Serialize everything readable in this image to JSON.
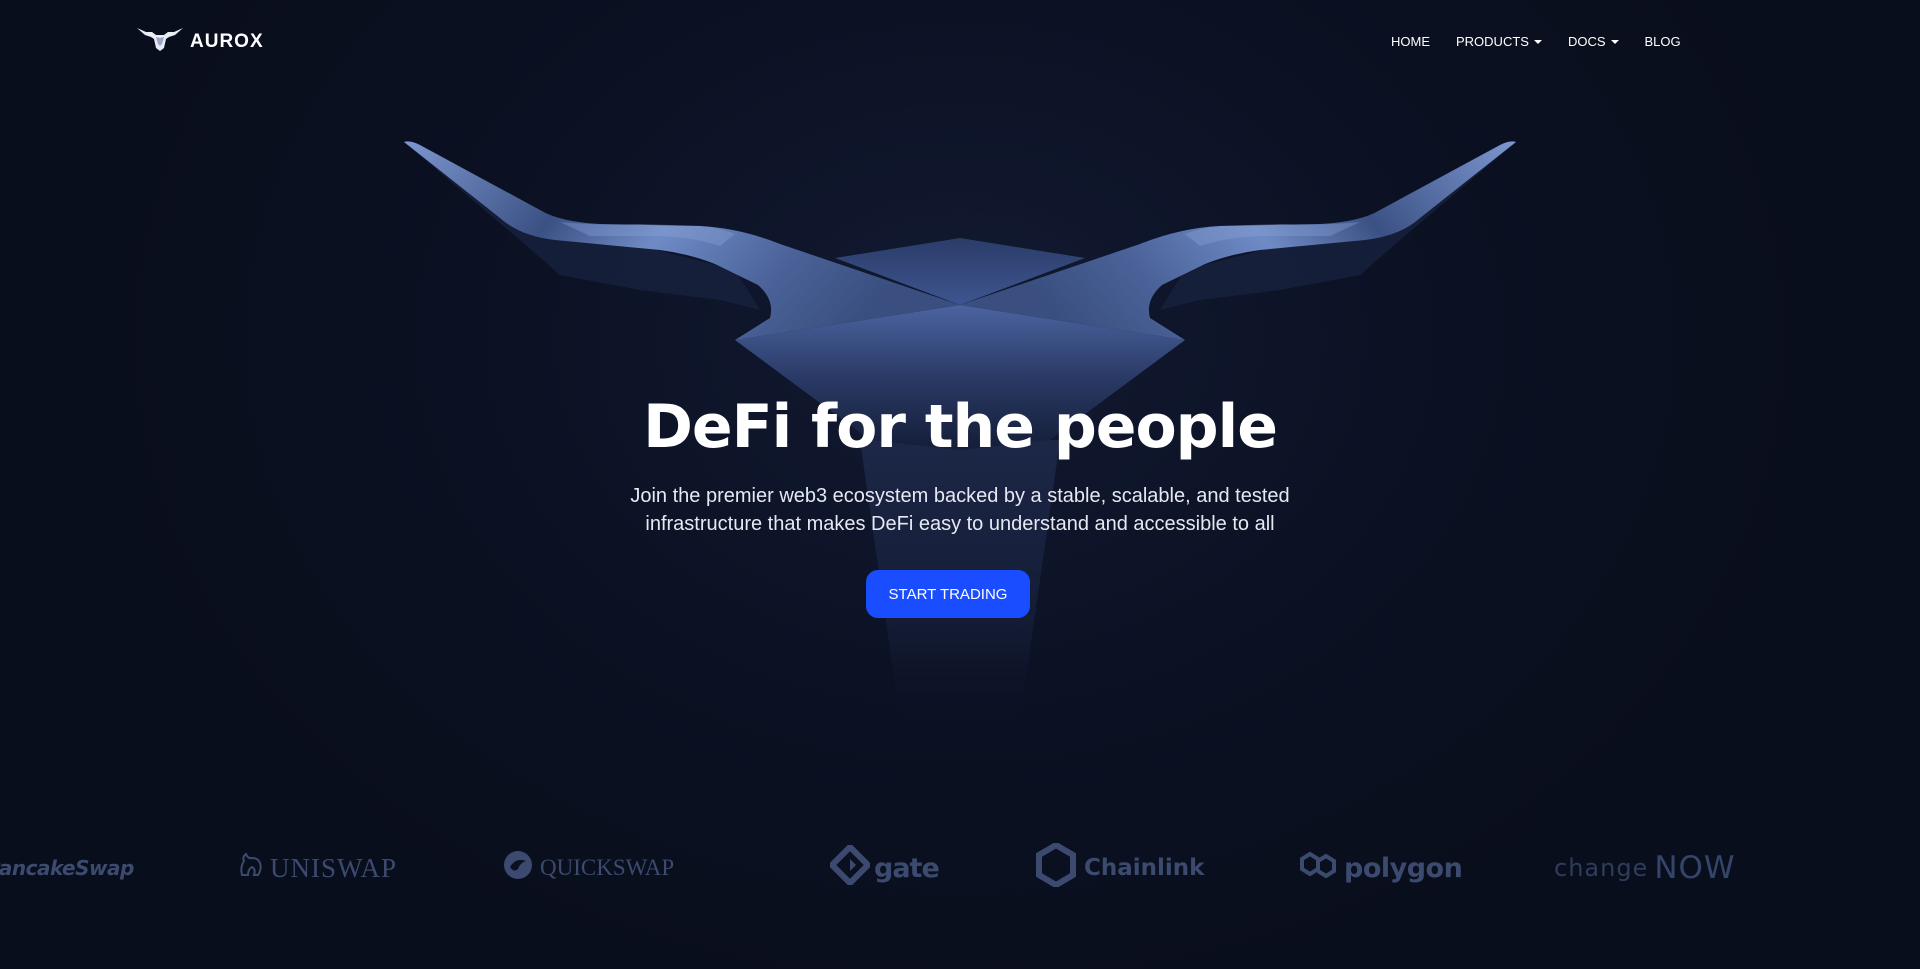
{
  "brand": {
    "name": "AUROX"
  },
  "nav": {
    "items": [
      {
        "label": "HOME",
        "dropdown": false
      },
      {
        "label": "PRODUCTS",
        "dropdown": true
      },
      {
        "label": "DOCS",
        "dropdown": true
      },
      {
        "label": "BLOG",
        "dropdown": false
      }
    ]
  },
  "hero": {
    "title": "DeFi for the people",
    "subtitle_line1": "Join the premier web3 ecosystem backed by a stable, scalable, and tested",
    "subtitle_line2": "infrastructure that makes DeFi easy to understand and accessible to all",
    "cta_label": "START TRADING"
  },
  "partners": {
    "pancakeswap": "PancakeSwap",
    "uniswap": "UNISWAP",
    "quickswap": "QUICKSWAP",
    "gate": "gate",
    "chainlink": "Chainlink",
    "polygon": "polygon",
    "changenow_a": "change",
    "changenow_b": "NOW"
  },
  "colors": {
    "background": "#0b1122",
    "accent": "#1a4dff",
    "partner_logo": "#3b4a6e",
    "bull_highlight": "#6f8bc6"
  },
  "icons": [
    "bull-logo-icon",
    "caret-down-icon",
    "bull-hero-icon",
    "uniswap-unicorn-icon",
    "quickswap-dragon-icon",
    "gate-icon",
    "chainlink-hexagon-icon",
    "polygon-icon"
  ]
}
